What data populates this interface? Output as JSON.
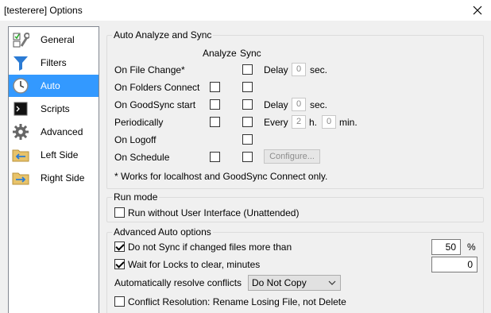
{
  "window": {
    "title": "[testerere] Options",
    "close_icon": "close-icon"
  },
  "sidebar": {
    "items": [
      {
        "label": "General",
        "icon": "general-wrench-icon",
        "selected": false
      },
      {
        "label": "Filters",
        "icon": "filter-funnel-icon",
        "selected": false
      },
      {
        "label": "Auto",
        "icon": "clock-icon",
        "selected": true
      },
      {
        "label": "Scripts",
        "icon": "terminal-icon",
        "selected": false
      },
      {
        "label": "Advanced",
        "icon": "gear-icon",
        "selected": false
      },
      {
        "label": "Left Side",
        "icon": "folder-left-icon",
        "selected": false
      },
      {
        "label": "Right Side",
        "icon": "folder-right-icon",
        "selected": false
      }
    ]
  },
  "auto_analyze": {
    "title": "Auto Analyze and Sync",
    "col_analyze": "Analyze",
    "col_sync": "Sync",
    "rows": {
      "file_change": {
        "label": "On File Change*",
        "delay_label": "Delay",
        "delay_value": "0",
        "unit": "sec."
      },
      "folders_connect": {
        "label": "On Folders Connect"
      },
      "goodsync_start": {
        "label": "On GoodSync start",
        "delay_label": "Delay",
        "delay_value": "0",
        "unit": "sec."
      },
      "periodically": {
        "label": "Periodically",
        "every_label": "Every",
        "hours_value": "2",
        "hours_unit": "h.",
        "minutes_value": "0",
        "minutes_unit": "min."
      },
      "logoff": {
        "label": "On Logoff"
      },
      "schedule": {
        "label": "On Schedule",
        "configure_label": "Configure..."
      }
    },
    "footnote": "* Works for localhost and GoodSync Connect only."
  },
  "run_mode": {
    "title": "Run mode",
    "unattended_label": "Run without User Interface (Unattended)",
    "unattended_checked": false
  },
  "advanced_auto": {
    "title": "Advanced Auto options",
    "no_sync_label": "Do not Sync if changed files more than",
    "no_sync_checked": true,
    "no_sync_value": "50",
    "no_sync_unit": "%",
    "wait_locks_label": "Wait for Locks to clear, minutes",
    "wait_locks_checked": true,
    "wait_locks_value": "0",
    "resolve_label": "Automatically resolve conflicts",
    "resolve_value": "Do Not Copy",
    "conflict_label": "Conflict Resolution: Rename Losing File, not Delete",
    "conflict_checked": false
  },
  "colors": {
    "selection": "#3399ff",
    "dialog_bg": "#f0f0f0"
  }
}
